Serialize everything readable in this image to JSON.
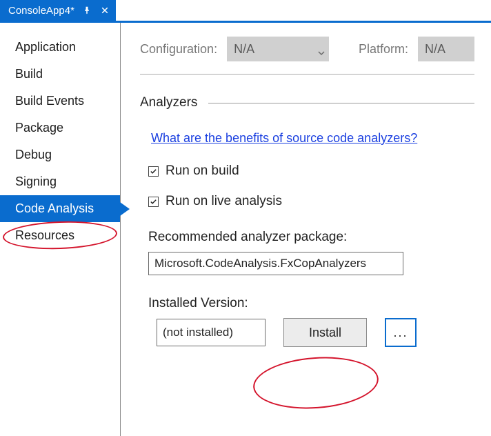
{
  "tab": {
    "title": "ConsoleApp4*"
  },
  "sidebar": {
    "items": [
      {
        "label": "Application"
      },
      {
        "label": "Build"
      },
      {
        "label": "Build Events"
      },
      {
        "label": "Package"
      },
      {
        "label": "Debug"
      },
      {
        "label": "Signing"
      },
      {
        "label": "Code Analysis",
        "selected": true
      },
      {
        "label": "Resources"
      }
    ]
  },
  "config": {
    "configuration_label": "Configuration:",
    "configuration_value": "N/A",
    "platform_label": "Platform:",
    "platform_value": "N/A"
  },
  "analyzers": {
    "section_title": "Analyzers",
    "help_link": "What are the benefits of source code analyzers?",
    "run_on_build_label": "Run on build",
    "run_on_build_checked": true,
    "run_on_live_label": "Run on live analysis",
    "run_on_live_checked": true,
    "recommended_label": "Recommended analyzer package:",
    "recommended_value": "Microsoft.CodeAnalysis.FxCopAnalyzers",
    "installed_label": "Installed Version:",
    "installed_value": "(not installed)",
    "install_button": "Install",
    "more_button": "..."
  }
}
